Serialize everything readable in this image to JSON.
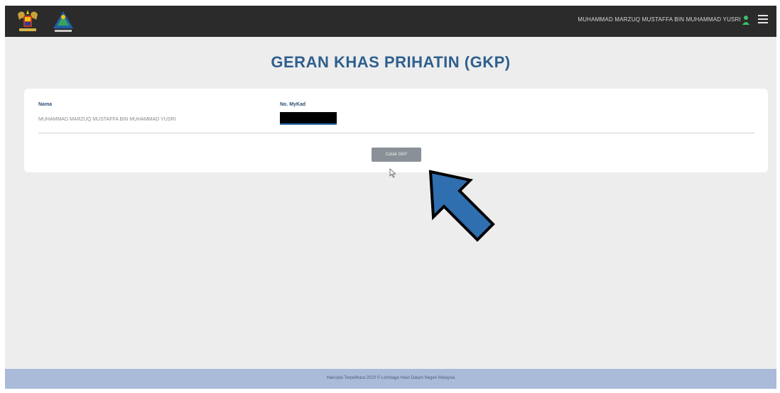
{
  "page": {
    "title": "GERAN KHAS PRIHATIN (GKP)"
  },
  "header": {
    "user_name": "MUHAMMAD MARZUQ MUSTAFFA BIN MUHAMMAD YUSRI",
    "icons": [
      "coat-of-arms-logo",
      "lhdn-logo",
      "user-icon",
      "menu-icon"
    ]
  },
  "form": {
    "nama_label": "Nama",
    "nama_value": "MUHAMMAD MARZUQ MUSTAFFA BIN MUHAMMAD YUSRI",
    "mykad_label": "No. MyKad"
  },
  "actions": {
    "cetak_label": "Cetak GKP"
  },
  "footer": {
    "text": "Hakcipta Terpelihara 2020 © Lembaga Hasil Dalam Negeri Malaysia"
  },
  "colors": {
    "topbar": "#2b2b2b",
    "title": "#2e5f8e",
    "footer": "#a9bbd9",
    "button": "#8a9097",
    "annotation_arrow": "#2f6fb0"
  }
}
